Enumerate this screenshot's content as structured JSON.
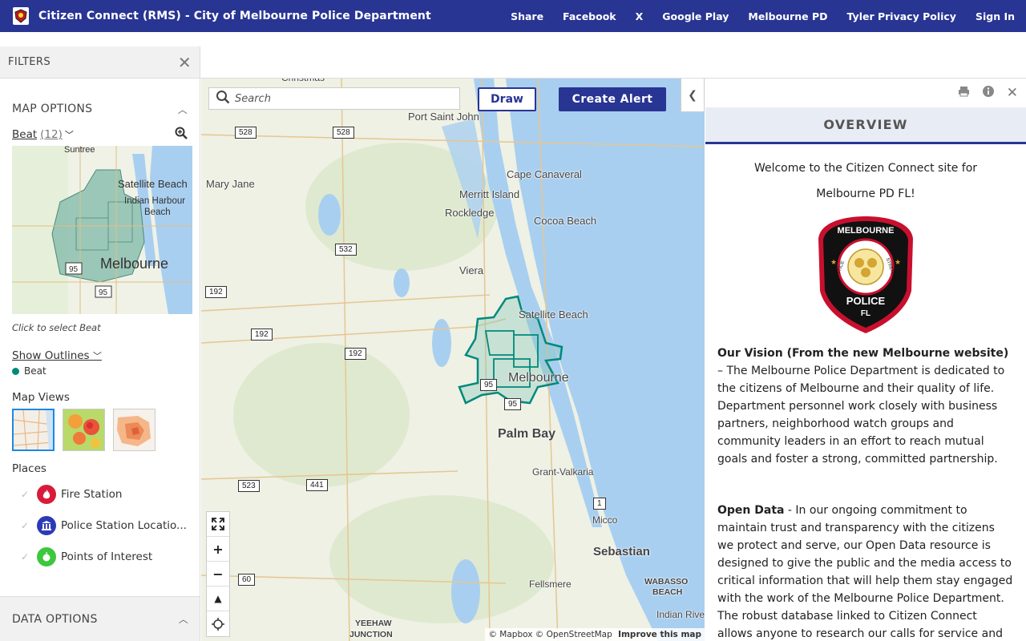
{
  "header": {
    "title": "Citizen Connect (RMS) - City of Melbourne Police Department",
    "nav": [
      "Share",
      "Facebook",
      "X",
      "Google Play",
      "Melbourne PD",
      "Tyler Privacy Policy",
      "Sign In"
    ]
  },
  "filters": {
    "title": "FILTERS",
    "map_options": "MAP OPTIONS",
    "beat_label": "Beat",
    "beat_count": "(12)",
    "beat_hint": "Click to select Beat",
    "show_outlines": "Show Outlines",
    "legend_beat": "Beat",
    "map_views_title": "Map Views",
    "places_title": "Places",
    "places": [
      "Fire Station",
      "Police Station Locatio...",
      "Points of Interest"
    ],
    "data_options": "DATA OPTIONS",
    "mini_map_labels": [
      "Suntree",
      "Satellite Beach",
      "Indian Harbour",
      "Beach",
      "Melbourne",
      "95",
      "95"
    ]
  },
  "map": {
    "search_placeholder": "Search",
    "draw_label": "Draw",
    "create_alert_label": "Create Alert",
    "attribution": "© Mapbox © OpenStreetMap",
    "improve": "Improve this map",
    "places": [
      {
        "name": "Christmas"
      },
      {
        "name": "Port Saint John"
      },
      {
        "name": "Mary Jane"
      },
      {
        "name": "Cape Canaveral"
      },
      {
        "name": "Merritt Island"
      },
      {
        "name": "Rockledge"
      },
      {
        "name": "Cocoa Beach"
      },
      {
        "name": "Viera"
      },
      {
        "name": "Satellite Beach"
      },
      {
        "name": "Melbourne"
      },
      {
        "name": "Palm Bay"
      },
      {
        "name": "Grant-Valkaria"
      },
      {
        "name": "Micco"
      },
      {
        "name": "Sebastian"
      },
      {
        "name": "Fellsmere"
      },
      {
        "name": "WABASSO"
      },
      {
        "name": "BEACH"
      },
      {
        "name": "Indian River"
      },
      {
        "name": "YEEHAW"
      },
      {
        "name": "JUNCTION"
      }
    ],
    "roads": [
      "528",
      "528",
      "532",
      "192",
      "192",
      "192",
      "95",
      "95",
      "523",
      "441",
      "1",
      "60"
    ]
  },
  "overview": {
    "title": "OVERVIEW",
    "welcome_1": "Welcome to the Citizen Connect site for",
    "welcome_2": "Melbourne PD FL!",
    "badge_top": "MELBOURNE",
    "badge_justice": "JUSTICE",
    "badge_strength": "STRENGTH",
    "badge_police": "POLICE",
    "badge_fl": "FL",
    "vision_bold": "Our Vision (From the new Melbourne website)",
    "vision_text": " – The Melbourne Police Department is dedicated to the citizens of Melbourne and their quality of life. Department personnel work closely with business partners, neighborhood watch groups and community leaders in an effort to reach mutual goals and foster a strong, committed partnership.",
    "open_bold": "Open Data",
    "open_text": " - In our ongoing commitment to maintain trust and transparency with the citizens we protect and serve, our Open Data resource is designed to give the public and the media access to critical information that will help them stay engaged with the work of the Melbourne Police Department. The robust database linked to Citizen Connect allows anyone to research our calls for service and track certain data, while"
  },
  "colors": {
    "brand": "#283593",
    "beat": "#00897b",
    "water": "#a9cff0"
  }
}
